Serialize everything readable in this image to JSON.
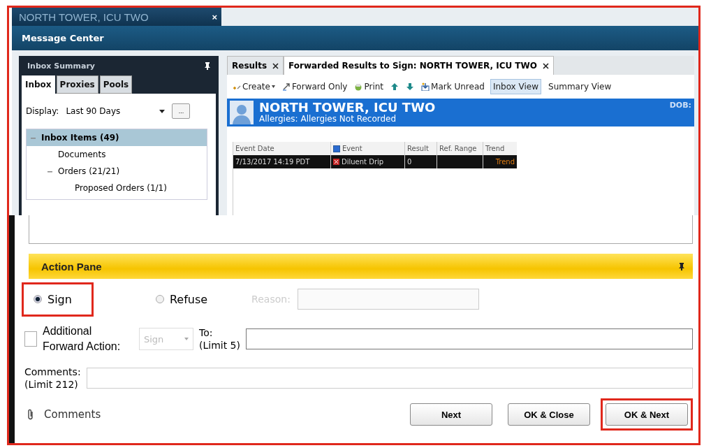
{
  "window": {
    "title": "NORTH TOWER, ICU TWO",
    "close": "×"
  },
  "header": {
    "title": "Message Center"
  },
  "inbox_summary": {
    "title": "Inbox Summary",
    "tabs": [
      {
        "label": "Inbox",
        "selected": true
      },
      {
        "label": "Proxies",
        "selected": false
      },
      {
        "label": "Pools",
        "selected": false
      }
    ],
    "display": {
      "label": "Display:",
      "value": "Last 90 Days",
      "more": "..."
    },
    "tree": [
      {
        "label": "Inbox Items (49)",
        "expanded": true,
        "selected": true,
        "children": [
          {
            "label": "Documents",
            "selected": false
          },
          {
            "label": "Orders (21/21)",
            "expanded": true,
            "selected": false,
            "children": [
              {
                "label": "Proposed Orders (1/1)",
                "selected": false
              }
            ]
          }
        ]
      }
    ]
  },
  "tabs": [
    {
      "label": "Results",
      "selected": false
    },
    {
      "label": "Forwarded Results to Sign: NORTH TOWER, ICU TWO",
      "selected": true
    }
  ],
  "toolbar": [
    {
      "kind": "menu",
      "label": "Create"
    },
    {
      "kind": "button",
      "label": "Forward Only"
    },
    {
      "kind": "button",
      "label": "Print"
    },
    {
      "kind": "icon"
    },
    {
      "kind": "icon"
    },
    {
      "kind": "button",
      "label": "Mark Unread"
    },
    {
      "kind": "view",
      "label": "Inbox View",
      "selected": true
    },
    {
      "kind": "view",
      "label": "Summary View",
      "selected": false
    }
  ],
  "patient": {
    "name": "NORTH TOWER, ICU TWO",
    "allergies": "Allergies: Allergies Not Recorded",
    "dob": "DOB:"
  },
  "results": {
    "columns": [
      {
        "label": "Event Date"
      },
      {
        "label": "Event",
        "checked": true
      },
      {
        "label": "Result"
      },
      {
        "label": "Ref. Range"
      },
      {
        "label": "Trend"
      }
    ],
    "rows": [
      {
        "event_date": "7/13/2017 14:19 PDT",
        "event": "Diluent Drip",
        "result": "0",
        "trend": "Trend",
        "selected": true
      }
    ]
  },
  "action_pane": {
    "title": "Action Pane",
    "options": [
      {
        "label": "Sign",
        "selected": true,
        "highlighted": true
      },
      {
        "label": "Refuse",
        "selected": false,
        "highlighted": false
      }
    ],
    "reason": {
      "label": "Reason:",
      "disabled": true
    },
    "forward": {
      "label": "Additional Forward Action:",
      "checked": false,
      "action": "Sign",
      "disabled": true
    },
    "to": {
      "label": "To:",
      "hint": "(Limit 5)"
    },
    "comments": {
      "label": "Comments:",
      "hint": "(Limit 212)"
    },
    "attachment": {
      "label": "Comments"
    }
  },
  "buttons": [
    {
      "label": "Next",
      "highlighted": false
    },
    {
      "label": "OK & Close",
      "highlighted": false
    },
    {
      "label": "OK & Next",
      "highlighted": true
    }
  ]
}
